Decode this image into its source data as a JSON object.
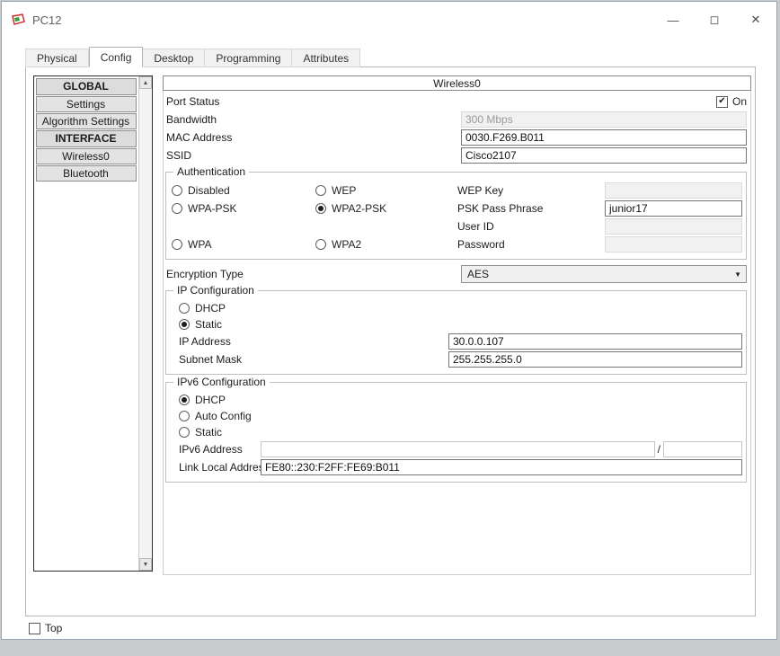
{
  "window": {
    "title": "PC12",
    "controls": {
      "minimize": "—",
      "maximize": "◻",
      "close": "✕"
    }
  },
  "tabs": [
    {
      "label": "Physical"
    },
    {
      "label": "Config"
    },
    {
      "label": "Desktop"
    },
    {
      "label": "Programming"
    },
    {
      "label": "Attributes"
    }
  ],
  "sidebar": {
    "global_header": "GLOBAL",
    "settings": "Settings",
    "algorithm_settings": "Algorithm Settings",
    "interface_header": "INTERFACE",
    "wireless0": "Wireless0",
    "bluetooth": "Bluetooth"
  },
  "panel": {
    "title": "Wireless0",
    "port_status": {
      "label": "Port Status",
      "on": "On",
      "checked": true
    },
    "bandwidth": {
      "label": "Bandwidth",
      "value": "300 Mbps"
    },
    "mac": {
      "label": "MAC Address",
      "value": "0030.F269.B011"
    },
    "ssid": {
      "label": "SSID",
      "value": "Cisco2107"
    },
    "auth": {
      "title": "Authentication",
      "radios": [
        {
          "label": "Disabled",
          "selected": false
        },
        {
          "label": "WEP",
          "selected": false
        },
        {
          "label": "WPA-PSK",
          "selected": false
        },
        {
          "label": "WPA2-PSK",
          "selected": true
        },
        {
          "label": "WPA",
          "selected": false
        },
        {
          "label": "WPA2",
          "selected": false
        }
      ],
      "wep_key_label": "WEP Key",
      "wep_key_value": "",
      "psk_label": "PSK Pass Phrase",
      "psk_value": "junior17",
      "user_id_label": "User ID",
      "user_id_value": "",
      "password_label": "Password",
      "password_value": ""
    },
    "encryption": {
      "label": "Encryption Type",
      "value": "AES"
    },
    "ip": {
      "title": "IP Configuration",
      "dhcp": {
        "label": "DHCP",
        "selected": false
      },
      "static": {
        "label": "Static",
        "selected": true
      },
      "ip_label": "IP Address",
      "ip_value": "30.0.0.107",
      "mask_label": "Subnet Mask",
      "mask_value": "255.255.255.0"
    },
    "ipv6": {
      "title": "IPv6 Configuration",
      "dhcp": {
        "label": "DHCP",
        "selected": true
      },
      "auto": {
        "label": "Auto Config",
        "selected": false
      },
      "static": {
        "label": "Static",
        "selected": false
      },
      "addr_label": "IPv6 Address",
      "addr_value": "",
      "slash": "/",
      "prefix_value": "",
      "link_label": "Link Local Address:",
      "link_value": "FE80::230:F2FF:FE69:B011"
    }
  },
  "footer": {
    "top": "Top",
    "checked": false
  }
}
